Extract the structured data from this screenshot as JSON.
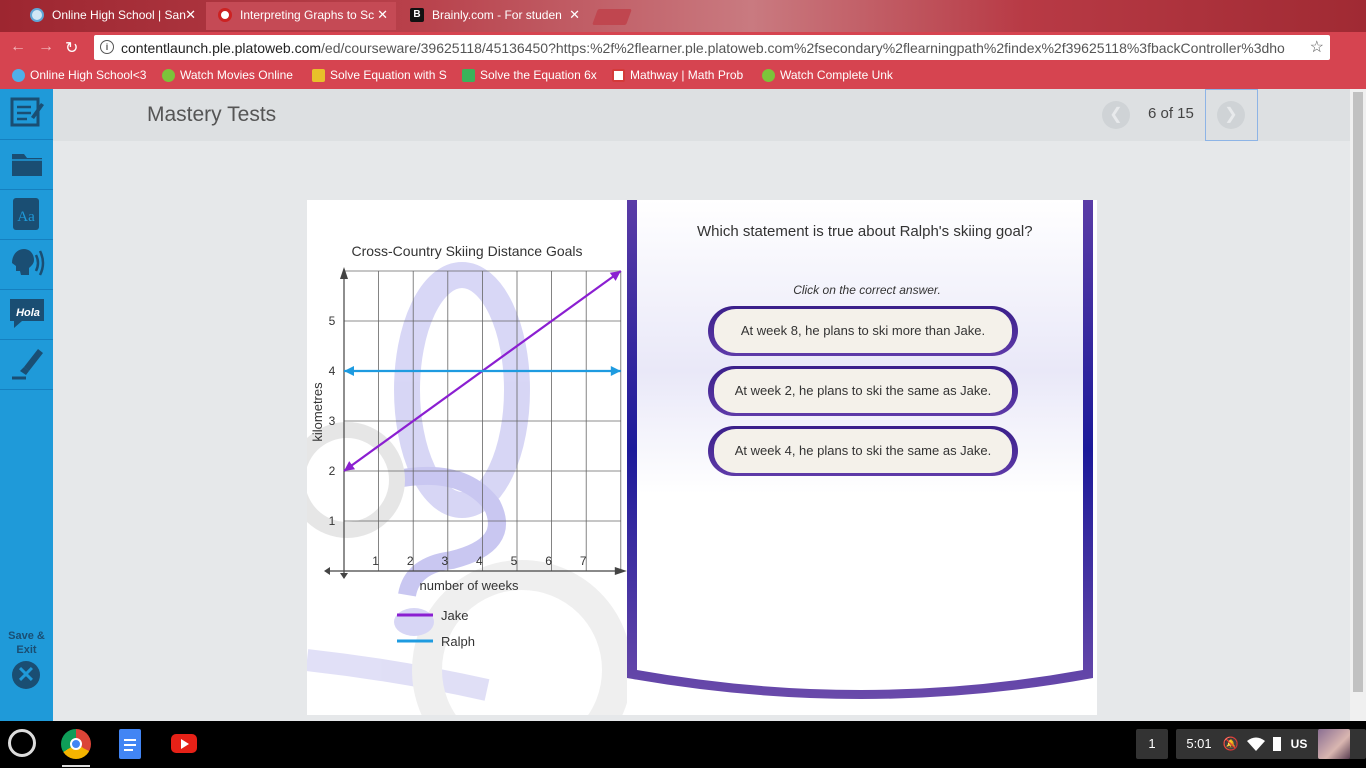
{
  "browser": {
    "tabs": [
      {
        "label": "Online High School | San",
        "active": false,
        "icon": "globe-icon"
      },
      {
        "label": "Interpreting Graphs to Sc",
        "active": true,
        "icon": "plato-icon"
      },
      {
        "label": "Brainly.com - For studen",
        "active": false,
        "icon": "brainly-icon"
      }
    ],
    "url_host": "contentlaunch.ple.platoweb.com",
    "url_path": "/ed/courseware/39625118/45136450?https:%2f%2flearner.ple.platoweb.com%2fsecondary%2flearningpath%2findex%2f39625118%3fbackController%3dho",
    "bookmarks": [
      {
        "label": "Online High School<3",
        "color": "#4fb0e8"
      },
      {
        "label": "Watch Movies Online",
        "color": "#7cc43a"
      },
      {
        "label": "Solve Equation with S",
        "color": "#e8c02a"
      },
      {
        "label": "Solve the Equation 6x",
        "color": "#3ab35a"
      },
      {
        "label": "Mathway | Math Prob",
        "color": "#d43a3a"
      },
      {
        "label": "Watch Complete Unk",
        "color": "#7cc43a"
      }
    ]
  },
  "app": {
    "page_title": "Mastery Tests",
    "pagination": "6 of 15",
    "save_exit": "Save &\nExit",
    "sidebar_icons": [
      "notes-icon",
      "folder-icon",
      "dictionary-icon",
      "speech-icon",
      "translate-icon",
      "highlighter-icon"
    ],
    "translate_label": "Hola",
    "dictionary_label": "Aa"
  },
  "question": {
    "text": "Which statement is true about Ralph's skiing goal?",
    "instruction": "Click on the correct answer.",
    "answers": [
      "At week 8, he plans to ski more than Jake.",
      "At week 2, he plans to ski the same as Jake.",
      "At week 4, he plans to ski the same as Jake."
    ]
  },
  "chart_data": {
    "type": "line",
    "title": "Cross-Country Skiing Distance Goals",
    "xlabel": "number of weeks",
    "ylabel": "kilometres",
    "xlim": [
      0,
      8
    ],
    "ylim": [
      0,
      6
    ],
    "x_ticks": [
      1,
      2,
      3,
      4,
      5,
      6,
      7
    ],
    "y_ticks": [
      1,
      2,
      3,
      4,
      5
    ],
    "grid": true,
    "series": [
      {
        "name": "Jake",
        "color": "#8b1fd1",
        "x": [
          0,
          8
        ],
        "y": [
          2,
          6
        ]
      },
      {
        "name": "Ralph",
        "color": "#1e9be0",
        "x": [
          0,
          8
        ],
        "y": [
          4,
          4
        ]
      }
    ]
  },
  "taskbar": {
    "badge": "1",
    "time": "5:01",
    "locale": "US"
  }
}
